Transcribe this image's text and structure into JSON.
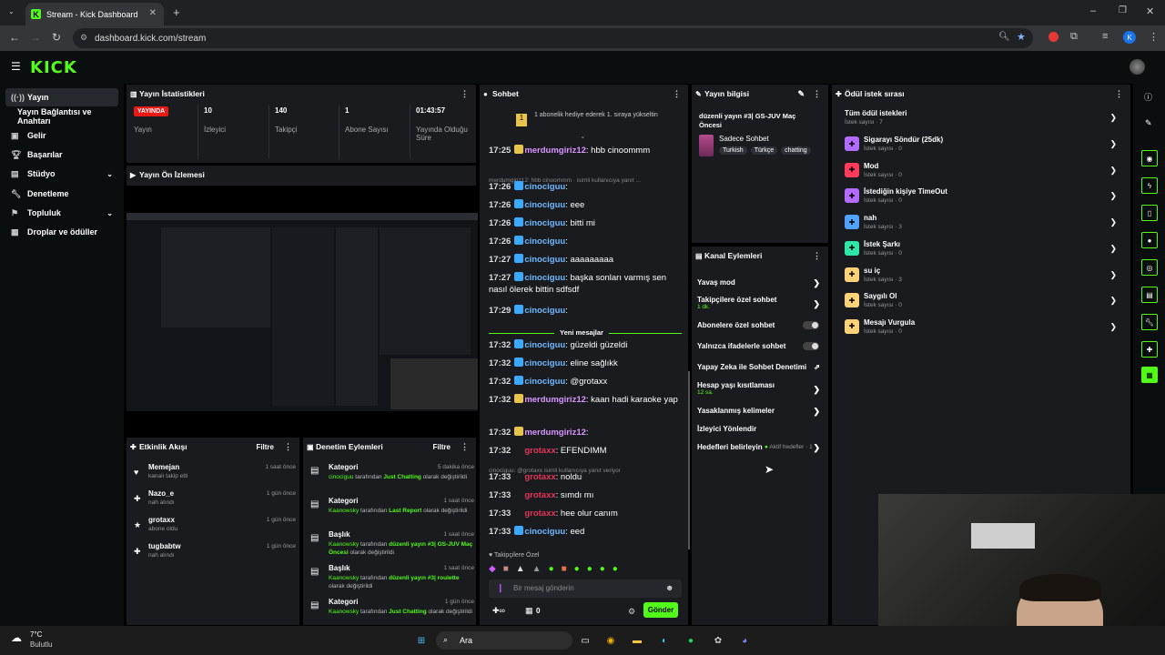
{
  "browser": {
    "tab_title": "Stream - Kick Dashboard",
    "url": "dashboard.kick.com/stream",
    "profile_initial": "K"
  },
  "brand": {
    "logo": "KICK",
    "accent": "#53fc18"
  },
  "sidebar": {
    "items": [
      {
        "label": "Yayın",
        "icon": "broadcast-icon"
      },
      {
        "label": "Yayın Bağlantısı ve Anahtarı",
        "icon": ""
      },
      {
        "label": "Gelir",
        "icon": "dollar-icon"
      },
      {
        "label": "Başarılar",
        "icon": "trophy-icon"
      },
      {
        "label": "Stüdyo",
        "icon": "studio-icon"
      },
      {
        "label": "Denetleme",
        "icon": "wrench-icon"
      },
      {
        "label": "Topluluk",
        "icon": "community-icon"
      },
      {
        "label": "Droplar ve ödüller",
        "icon": "gift-icon"
      }
    ]
  },
  "stats": {
    "title": "Yayın İstatistikleri",
    "live_badge": "YAYINDA",
    "status_label": "Yayın",
    "viewers": "10",
    "viewers_label": "İzleyici",
    "followers": "140",
    "followers_label": "Takipçi",
    "subs": "1",
    "subs_label": "Abone Sayısı",
    "uptime": "01:43:57",
    "uptime_label": "Yayında Olduğu Süre"
  },
  "preview": {
    "title": "Yayın Ön İzlemesi"
  },
  "activity": {
    "title": "Etkinlik Akışı",
    "filter": "Filtre",
    "items": [
      {
        "name": "Memejan",
        "sub": "kanalı takip etti",
        "time": "1 saat önce"
      },
      {
        "name": "Nazo_e",
        "sub": "nah alındı",
        "time": "1 gün önce"
      },
      {
        "name": "grotaxx",
        "sub": "abone oldu",
        "time": "1 gün önce"
      },
      {
        "name": "tugbabtw",
        "sub": "nah alındı",
        "time": "1 gün önce"
      }
    ]
  },
  "moderation": {
    "title": "Denetim Eylemleri",
    "filter": "Filtre",
    "items": [
      {
        "type": "Kategori",
        "actor": "cinociguu",
        "mid": " tarafından ",
        "value": "Just Chatting",
        "tail": " olarak değiştirildi",
        "time": "5 dakika önce"
      },
      {
        "type": "Kategori",
        "actor": "Kaanowsky",
        "mid": " tarafından ",
        "value": "Last Report",
        "tail": " olarak değiştirildi",
        "time": "1 saat önce"
      },
      {
        "type": "Başlık",
        "actor": "Kaanowsky",
        "mid": " tarafından ",
        "value": "düzenli yayın #3| GS-JUV Maç Öncesi",
        "tail": " olarak değiştirildi",
        "time": "1 saat önce"
      },
      {
        "type": "Başlık",
        "actor": "Kaanowsky",
        "mid": " tarafından ",
        "value": "düzenli yayın #3| roulette",
        "tail": " olarak değiştirildi",
        "time": "1 saat önce"
      },
      {
        "type": "Kategori",
        "actor": "Kaanowsky",
        "mid": " tarafından ",
        "value": "Just Chatting",
        "tail": " olarak değiştirildi",
        "time": "1 gün önce"
      }
    ]
  },
  "chat": {
    "title": "Sohbet",
    "pinned": "1 abonelik hediye ederek 1. sıraya yükseltin",
    "reply1": "merdumgiriz12: hbb cinoommm  ·  isimli kullanıcıya yanıt ...",
    "reply2": "cinociguu: @grotaxx isimli kullanıcıya yanıt veriyor",
    "new_messages": "Yeni mesajlar",
    "followers_only": "Takipçilere Özel",
    "placeholder": "Bir mesaj gönderin",
    "points": "0",
    "send": "Gönder",
    "messages": [
      {
        "time": "17:25",
        "user": "merdumgiriz12",
        "cls": "u-mer",
        "text": ": hbb cinoommm"
      },
      {
        "time": "17:26",
        "user": "cinociguu",
        "cls": "u-cin",
        "text": ":"
      },
      {
        "time": "17:26",
        "user": "cinociguu",
        "cls": "u-cin",
        "text": ": eee"
      },
      {
        "time": "17:26",
        "user": "cinociguu",
        "cls": "u-cin",
        "text": ": bitti mi"
      },
      {
        "time": "17:26",
        "user": "cinociguu",
        "cls": "u-cin",
        "text": ":"
      },
      {
        "time": "17:27",
        "user": "cinociguu",
        "cls": "u-cin",
        "text": ": aaaaaaaaa"
      },
      {
        "time": "17:27",
        "user": "cinociguu",
        "cls": "u-cin",
        "text": ": başka sonları varmış sen nasıl ölerek bittin sdfsdf"
      },
      {
        "time": "17:29",
        "user": "cinociguu",
        "cls": "u-cin",
        "text": ":"
      },
      {
        "time": "17:32",
        "user": "cinociguu",
        "cls": "u-cin",
        "text": ": güzeldi güzeldi"
      },
      {
        "time": "17:32",
        "user": "cinociguu",
        "cls": "u-cin",
        "text": ": eline sağlıkk"
      },
      {
        "time": "17:32",
        "user": "cinociguu",
        "cls": "u-cin",
        "text": ": @grotaxx"
      },
      {
        "time": "17:32",
        "user": "merdumgiriz12",
        "cls": "u-mer",
        "text": ": kaan hadi karaoke yap"
      },
      {
        "time": "17:32",
        "user": "merdumgiriz12",
        "cls": "u-mer",
        "text": ":"
      },
      {
        "time": "17:32",
        "user": "grotaxx",
        "cls": "u-gro",
        "text": ": EFENDIMM"
      },
      {
        "time": "17:33",
        "user": "grotaxx",
        "cls": "u-gro",
        "text": ": noldu"
      },
      {
        "time": "17:33",
        "user": "grotaxx",
        "cls": "u-gro",
        "text": ": sımdı mı"
      },
      {
        "time": "17:33",
        "user": "grotaxx",
        "cls": "u-gro",
        "text": ": hee olur canım"
      },
      {
        "time": "17:33",
        "user": "cinociguu",
        "cls": "u-cin",
        "text": ": eed"
      }
    ]
  },
  "stream_info": {
    "title": "Yayın bilgisi",
    "stream_title": "düzenli yayın #3| GS-JUV Maç Öncesi",
    "category": "Sadece Sohbet",
    "tags": [
      "Turkish",
      "Türkçe",
      "chatting"
    ]
  },
  "channel_actions": {
    "title": "Kanal Eylemleri",
    "slow_mode": "Yavaş mod",
    "followers_chat": "Takipçilere özel sohbet",
    "followers_chat_sub": "1 dk.",
    "subs_chat": "Abonelere özel sohbet",
    "emotes_chat": "Yalnızca ifadelerle sohbet",
    "ai_mod": "Yapay Zeka ile Sohbet Denetimi",
    "account_age": "Hesap yaşı kısıtlaması",
    "account_age_sub": "12 sa.",
    "banned_words": "Yasaklanmış kelimeler",
    "redirect": "İzleyici Yönlendir",
    "goals": "Hedefleri belirleyin",
    "goals_status": "Aktif hedefler · 1"
  },
  "rewards": {
    "title": "Ödül istek sırası",
    "all": "Tüm ödül istekleri",
    "all_count": "İstek sayısı · 7",
    "items": [
      {
        "name": "Sigarayı Söndür (25dk)",
        "count": "İstek sayısı · 0",
        "color": "#b36bff"
      },
      {
        "name": "Mod",
        "count": "İstek sayısı · 0",
        "color": "#ff3b5c"
      },
      {
        "name": "İstediğin kişiye TimeOut",
        "count": "İstek sayısı · 0",
        "color": "#b36bff"
      },
      {
        "name": "nah",
        "count": "İstek sayısı · 3",
        "color": "#4fa3ff"
      },
      {
        "name": "İstek Şarkı",
        "count": "İstek sayısı · 0",
        "color": "#2ee6a8"
      },
      {
        "name": "su iç",
        "count": "İstek sayısı · 3",
        "color": "#ffd27a"
      },
      {
        "name": "Saygılı Ol",
        "count": "İstek sayısı · 0",
        "color": "#ffd27a"
      },
      {
        "name": "Mesajı Vurgula",
        "count": "İstek sayısı · 0",
        "color": "#ffd27a"
      }
    ]
  },
  "taskbar": {
    "weather_temp": "7°C",
    "weather_desc": "Bulutlu",
    "search": "Ara"
  }
}
